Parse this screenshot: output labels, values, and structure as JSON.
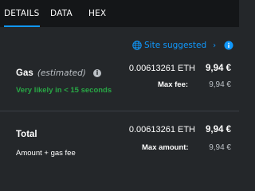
{
  "tabs": [
    {
      "label": "DETAILS",
      "active": true
    },
    {
      "label": "DATA",
      "active": false
    },
    {
      "label": "HEX",
      "active": false
    }
  ],
  "site_suggested": {
    "label": "Site suggested",
    "icon": "globe-icon",
    "chevron": "›"
  },
  "gas": {
    "label": "Gas",
    "qualifier": "(estimated)",
    "eth_amount": "0.00613261 ETH",
    "fiat_amount": "9,94 €",
    "speed_text": "Very likely in < 15 seconds",
    "max_fee_label": "Max fee:",
    "max_fee_value": "9,94 €"
  },
  "total": {
    "label": "Total",
    "eth_amount": "0.00613261 ETH",
    "fiat_amount": "9,94 €",
    "sub_label": "Amount + gas fee",
    "max_amount_label": "Max amount:",
    "max_amount_value": "9,94 €"
  },
  "colors": {
    "accent": "#1098fc",
    "success": "#28a745",
    "background": "#24272a",
    "tab_bar": "#141618"
  }
}
